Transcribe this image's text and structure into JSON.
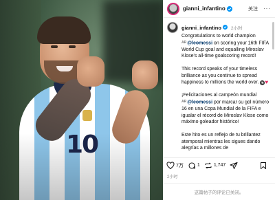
{
  "post": {
    "username": "gianni_infantino",
    "follow_label": "关注",
    "more_label": "···",
    "time_ago": "2小时",
    "caption": {
      "p1_before": "Congratulations to world champion ",
      "p1_mention": "@leomessi",
      "p1_after": " on scoring your 16th FIFA World Cup goal and equalling Miroslav Klose's all-time goalscoring record!",
      "p2": "This record speaks of your timeless brilliance as you continue to spread happiness to millions the world over.",
      "p3_before": "¡Felicitaciones al campeón mundial ",
      "p3_mention": "@leomessi",
      "p3_after": " por marcar su gol número 16 en una Copa Mundial de la FIFA e igualar el récord de Miroslav Klose como máximo goleador histórico!",
      "p4": "Este hito es un reflejo de tu brillantez atemporal mientras les sigues dando alegrías a millones de",
      "ar_tag": "AR"
    },
    "likes": "7万",
    "comments": "1",
    "shares": "1,747",
    "date": "2小时",
    "comments_disabled": "这篇帖子的评论已关闭。"
  },
  "media": {
    "jersey_number": "10"
  },
  "colors": {
    "link": "#00376b",
    "muted": "#8e8e8e",
    "heart": "#e0245e"
  },
  "icons": [
    "verified-icon",
    "more-icon",
    "heart-icon",
    "comment-icon",
    "repost-icon",
    "share-icon",
    "save-icon",
    "soccer-ball-icon",
    "heart-emoji-icon"
  ]
}
